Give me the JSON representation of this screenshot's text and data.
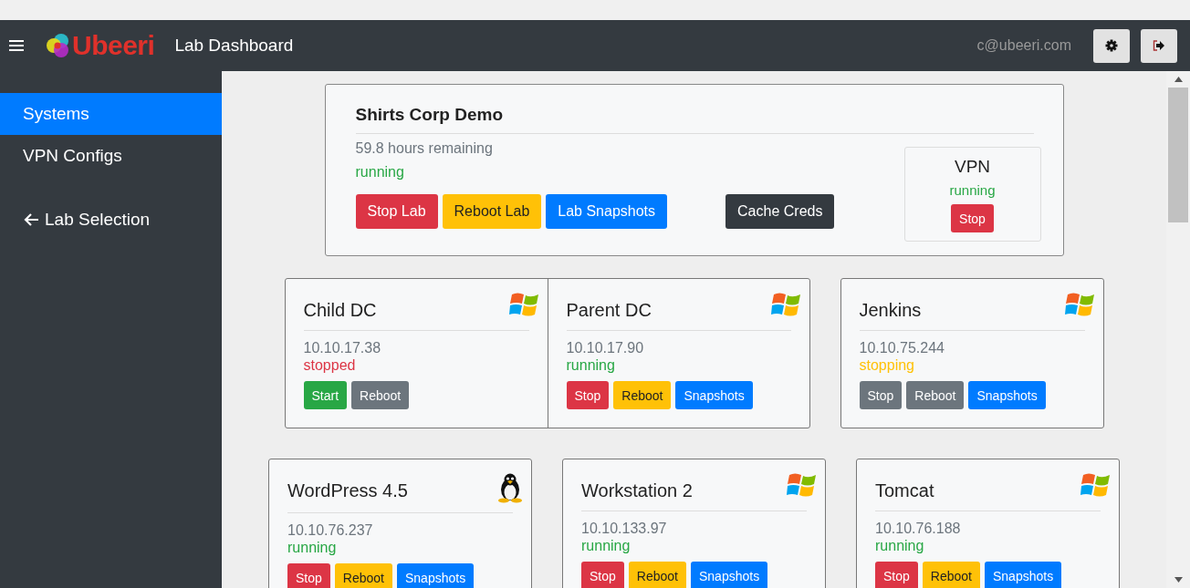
{
  "navbar": {
    "brand": "Ubeeri",
    "title": "Lab Dashboard",
    "user": "c@ubeeri.com"
  },
  "sidebar": {
    "items": [
      {
        "label": "Systems",
        "selected": true,
        "kind": "link"
      },
      {
        "label": "VPN Configs",
        "selected": false,
        "kind": "link"
      },
      {
        "label": "Lab Selection",
        "selected": false,
        "kind": "back"
      }
    ]
  },
  "lab": {
    "name": "Shirts Corp Demo",
    "remaining": "59.8 hours remaining",
    "status": {
      "text": "running",
      "kind": "ok"
    },
    "buttons": [
      {
        "label": "Stop Lab",
        "kind": "danger"
      },
      {
        "label": "Reboot Lab",
        "kind": "warning"
      },
      {
        "label": "Lab Snapshots",
        "kind": "primary"
      },
      {
        "label": "Cache Creds",
        "kind": "dark"
      }
    ],
    "vpn": {
      "title": "VPN",
      "status": {
        "text": "running",
        "kind": "ok"
      },
      "button": {
        "label": "Stop",
        "kind": "danger"
      }
    }
  },
  "system_groups": [
    {
      "systems": [
        {
          "name": "Child DC",
          "kind": "windows",
          "ip": "10.10.17.38",
          "status": {
            "text": "stopped",
            "kind": "bad"
          },
          "buttons": [
            {
              "label": "Start",
              "kind": "success"
            },
            {
              "label": "Reboot",
              "kind": "secondary"
            }
          ]
        },
        {
          "name": "Parent DC",
          "kind": "windows",
          "ip": "10.10.17.90",
          "status": {
            "text": "running",
            "kind": "ok"
          },
          "buttons": [
            {
              "label": "Stop",
              "kind": "danger"
            },
            {
              "label": "Reboot",
              "kind": "warning"
            },
            {
              "label": "Snapshots",
              "kind": "primary"
            }
          ]
        }
      ]
    },
    {
      "systems": [
        {
          "name": "Jenkins",
          "kind": "windows",
          "ip": "10.10.75.244",
          "status": {
            "text": "stopping",
            "kind": "busy"
          },
          "buttons": [
            {
              "label": "Stop",
              "kind": "secondary"
            },
            {
              "label": "Reboot",
              "kind": "secondary"
            },
            {
              "label": "Snapshots",
              "kind": "primary"
            }
          ]
        }
      ]
    },
    {
      "systems": [
        {
          "name": "WordPress 4.5",
          "kind": "linux",
          "ip": "10.10.76.237",
          "status": {
            "text": "running",
            "kind": "ok"
          },
          "buttons": [
            {
              "label": "Stop",
              "kind": "danger"
            },
            {
              "label": "Reboot",
              "kind": "warning"
            },
            {
              "label": "Snapshots",
              "kind": "primary"
            }
          ]
        }
      ]
    },
    {
      "systems": [
        {
          "name": "Workstation 2",
          "kind": "windows",
          "ip": "10.10.133.97",
          "status": {
            "text": "running",
            "kind": "ok"
          },
          "buttons": [
            {
              "label": "Stop",
              "kind": "danger"
            },
            {
              "label": "Reboot",
              "kind": "warning"
            },
            {
              "label": "Snapshots",
              "kind": "primary"
            }
          ]
        }
      ]
    },
    {
      "systems": [
        {
          "name": "Tomcat",
          "kind": "windows",
          "ip": "10.10.76.188",
          "status": {
            "text": "running",
            "kind": "ok"
          },
          "buttons": [
            {
              "label": "Stop",
              "kind": "danger"
            },
            {
              "label": "Reboot",
              "kind": "warning"
            },
            {
              "label": "Snapshots",
              "kind": "primary"
            }
          ]
        }
      ]
    }
  ]
}
